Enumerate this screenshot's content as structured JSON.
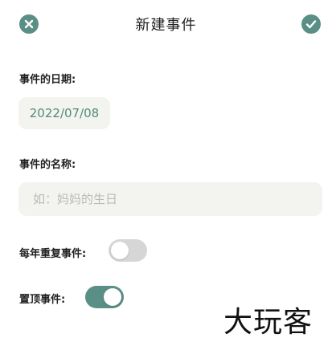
{
  "header": {
    "title": "新建事件",
    "close_icon": "close-icon",
    "confirm_icon": "check-icon"
  },
  "form": {
    "date_label": "事件的日期:",
    "date_value": "2022/07/08",
    "name_label": "事件的名称:",
    "name_value": "",
    "name_placeholder": "如：妈妈的生日",
    "repeat_label": "每年重复事件:",
    "repeat_on": false,
    "pin_label": "置顶事件:",
    "pin_on": true
  },
  "watermark": "大玩客",
  "colors": {
    "accent": "#5a8f86",
    "field_bg": "#f3f4ef",
    "toggle_off": "#d6d6d6"
  }
}
